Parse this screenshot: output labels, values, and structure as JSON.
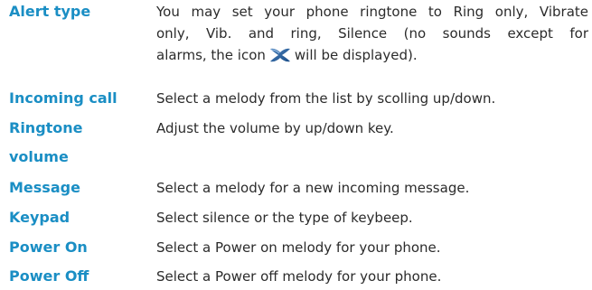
{
  "entries": [
    {
      "term": "Alert type",
      "desc_lines": [
        "You may set your phone ringtone to Ring only, Vibrate",
        "only, Vib. and ring, Silence (no sounds except for",
        "alarms, the icon",
        "will be displayed)."
      ],
      "icon": "silent-mode-icon"
    },
    {
      "term": "Incoming call",
      "desc": "Select a melody from the list by scolling up/down."
    },
    {
      "term_lines": [
        "Ringtone",
        "volume"
      ],
      "desc": "Adjust the volume by up/down key."
    },
    {
      "term": "Message",
      "desc": "Select a melody for a new incoming message."
    },
    {
      "term": "Keypad",
      "desc": "Select silence or the type of keybeep."
    },
    {
      "term": "Power On",
      "desc": "Select a Power on melody for your phone."
    },
    {
      "term": "Power Off",
      "desc": "Select a Power off melody for your phone."
    }
  ],
  "colors": {
    "term": "#1a8ec4",
    "body_text": "#2b2b2b"
  }
}
